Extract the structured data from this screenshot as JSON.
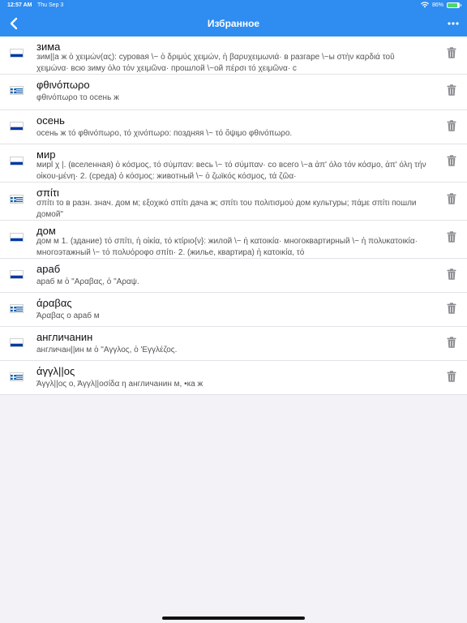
{
  "status": {
    "time": "12:57 AM",
    "date": "Thu Sep 3",
    "battery": "86%",
    "battery_level": 0.86
  },
  "header": {
    "title": "Избранное"
  },
  "colors": {
    "accent": "#2f8cf0",
    "trash": "#8e8e93"
  },
  "favorites": [
    {
      "flag": "ru",
      "word": "зима",
      "translation": "зим||а ж ὁ χειμών(ας): суровая \\~ ὁ δριμύς χειμών, ἡ βαρυχειμωνιά· в разгаре \\~ы στὴν καρδιά τοῦ χειμώνα· всю зиму όλο τόν χειμῶνα· прошлой \\~ой πέρσι τό χειμῶνα· с"
    },
    {
      "flag": "gr",
      "word": "φθινόπωρο",
      "translation": "φθινόπωρο το осень ж"
    },
    {
      "flag": "ru",
      "word": "осень",
      "translation": "осень ж τό φθινόπωρο, τό χινόπωρο: поздняя \\~ τό ὄψιμο φθινόπωρο."
    },
    {
      "flag": "ru",
      "word": "мир",
      "translation": "мирl χ |. (вселенная) ὁ κόσμος, τό σύμπαν: весь \\~ τό σύμπαν· со всего \\~а ἀπ' όλο τόν κόσμο, ἀπ' όλη τήν οἰκου-μένη· 2. (среда) ὁ κόσμος: животный \\~ ὁ ζωϊκός κόσμος, τά ζῶα·"
    },
    {
      "flag": "gr",
      "word": "σπίτι",
      "translation": "σπίτι το в разн. знач. дом м; εξοχικό σπίτι дача ж; σπίτι του πολιτισμού дом культуры; πάμε σπίτι пошли домой\""
    },
    {
      "flag": "ru",
      "word": "дом",
      "translation": "дом м 1. (здание) τό σπίτι, ἡ οἰκία, τό κτίριο{ν}: жилой \\~ ἡ κατοικία· многоквартирный \\~ ἡ πολυκατοικία· многоэтажный \\~ τό πολυόροφο σπίτι· 2. (жилье, квартира) ἡ κατοικία, τό"
    },
    {
      "flag": "ru",
      "word": "араб",
      "translation": "араб м ὁ \"Αραβας, ὁ \"Αραψ."
    },
    {
      "flag": "gr",
      "word": "άραβας",
      "translation": "Άραβας ο араб м"
    },
    {
      "flag": "ru",
      "word": "англичанин",
      "translation": "англичан||ин м ὁ \"Αγγλος, ὁ 'Εγγλέζος."
    },
    {
      "flag": "gr",
      "word": "άγγλ||ος",
      "translation": "Άγγλ||ος ο, Άγγλ||οσίδα η англичанин м, •ка ж"
    }
  ]
}
